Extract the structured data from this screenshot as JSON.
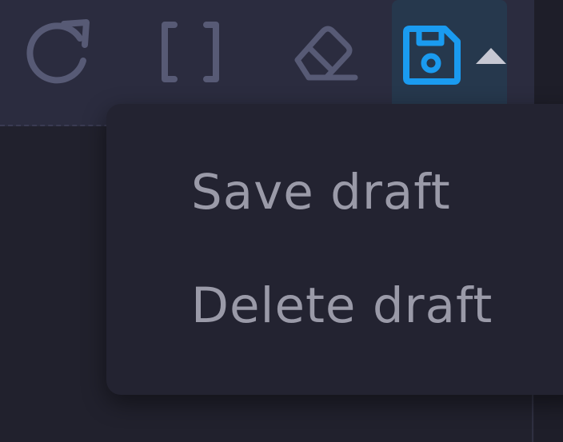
{
  "toolbar": {
    "icons": [
      "redo-icon",
      "brackets-icon",
      "eraser-icon",
      "save-icon",
      "caret-up-icon"
    ],
    "accent_color": "#1a9bf0"
  },
  "menu": {
    "items": [
      {
        "label": "Save draft"
      },
      {
        "label": "Delete draft"
      }
    ]
  }
}
